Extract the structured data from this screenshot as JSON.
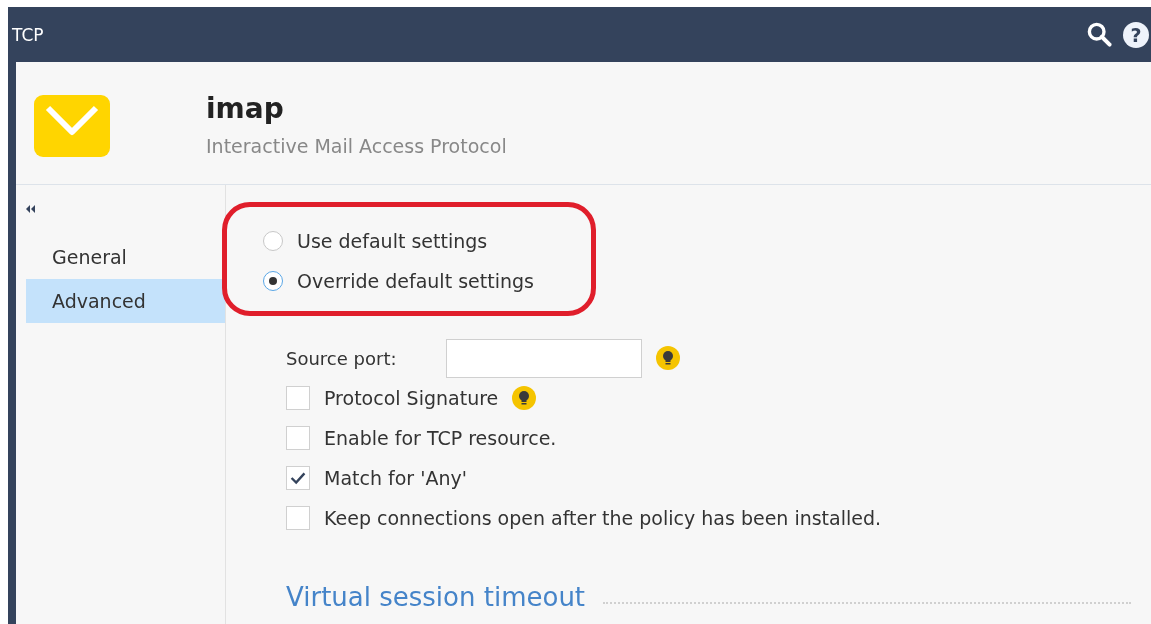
{
  "window": {
    "title": "TCP",
    "help": "?"
  },
  "header": {
    "title": "imap",
    "subtitle": "Interactive Mail Access Protocol"
  },
  "sidebar": {
    "items": [
      {
        "label": "General",
        "selected": false
      },
      {
        "label": "Advanced",
        "selected": true
      }
    ]
  },
  "mode": [
    {
      "label": "Use default settings",
      "selected": false
    },
    {
      "label": "Override default settings",
      "selected": true
    }
  ],
  "source_port": {
    "label": "Source port:",
    "hint": true
  },
  "options": [
    {
      "label": "Protocol Signature",
      "checked": false,
      "hint": true
    },
    {
      "label": "Enable for TCP resource.",
      "checked": false,
      "hint": false
    },
    {
      "label": "Match for 'Any'",
      "checked": true,
      "hint": false
    },
    {
      "label": "Keep connections open after the policy has been installed.",
      "checked": false,
      "hint": false
    }
  ],
  "section": {
    "title": "Virtual session timeout"
  }
}
